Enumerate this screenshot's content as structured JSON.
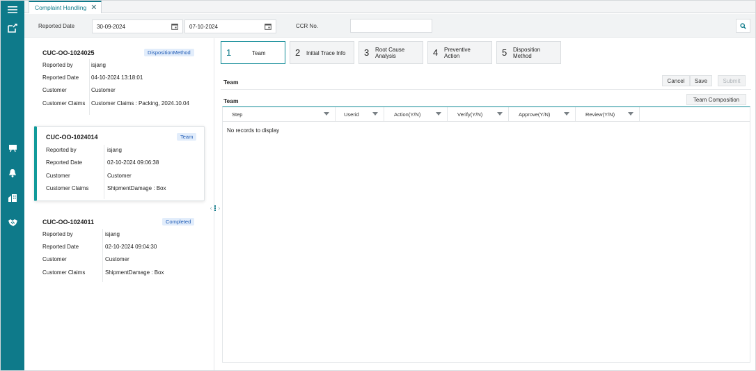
{
  "tab": {
    "label": "Complaint Handling"
  },
  "filters": {
    "reported_date_label": "Reported Date",
    "date_from": "30-09-2024",
    "date_to": "07-10-2024",
    "ccr_label": "CCR No.",
    "ccr_value": ""
  },
  "cards": [
    {
      "id": "CUC-OO-1024025",
      "badge": "DispositionMethod",
      "fields": [
        {
          "label": "Reported by",
          "value": "isjang"
        },
        {
          "label": "Reported Date",
          "value": "04-10-2024 13:18:01"
        },
        {
          "label": "Customer",
          "value": "Customer"
        },
        {
          "label": "Customer Claims",
          "value": "Customer Claims : Packing, 2024.10.04"
        }
      ]
    },
    {
      "id": "CUC-OO-1024014",
      "badge": "Team",
      "fields": [
        {
          "label": "Reported by",
          "value": "isjang"
        },
        {
          "label": "Reported Date",
          "value": "02-10-2024 09:06:38"
        },
        {
          "label": "Customer",
          "value": "Customer"
        },
        {
          "label": "Customer Claims",
          "value": "ShipmentDamage : Box"
        }
      ]
    },
    {
      "id": "CUC-OO-1024011",
      "badge": "Completed",
      "fields": [
        {
          "label": "Reported by",
          "value": "isjang"
        },
        {
          "label": "Reported Date",
          "value": "02-10-2024 09:04:30"
        },
        {
          "label": "Customer",
          "value": "Customer"
        },
        {
          "label": "Customer Claims",
          "value": "ShipmentDamage : Box"
        }
      ]
    }
  ],
  "steps": [
    {
      "num": "1",
      "label": "Team"
    },
    {
      "num": "2",
      "label": "Initial Trace Info"
    },
    {
      "num": "3",
      "label": "Root Cause\nAnalysis"
    },
    {
      "num": "4",
      "label": "Preventive\nAction"
    },
    {
      "num": "5",
      "label": "Disposition\nMethod"
    }
  ],
  "active_step": "1",
  "section_title": "Team",
  "actions": {
    "cancel": "Cancel",
    "save": "Save",
    "submit": "Submit"
  },
  "grid": {
    "title": "Team",
    "team_composition": "Team Composition",
    "columns": [
      "Step",
      "Userid",
      "Action(Y/N)",
      "Verify(Y/N)",
      "Approve(Y/N)",
      "Review(Y/N)"
    ],
    "empty_text": "No records to display"
  },
  "icons": {
    "rail": [
      "menu-icon",
      "export-icon",
      "board-icon",
      "bell-icon",
      "building-icon",
      "handshake-icon"
    ],
    "tab_close": "close-icon",
    "calendar": "calendar-icon",
    "search": "search-icon"
  },
  "colors": {
    "rail": "#0e7a8a",
    "accent": "#109a9a",
    "badge_bg": "#e2edfb",
    "badge_text": "#1f5bb5"
  }
}
